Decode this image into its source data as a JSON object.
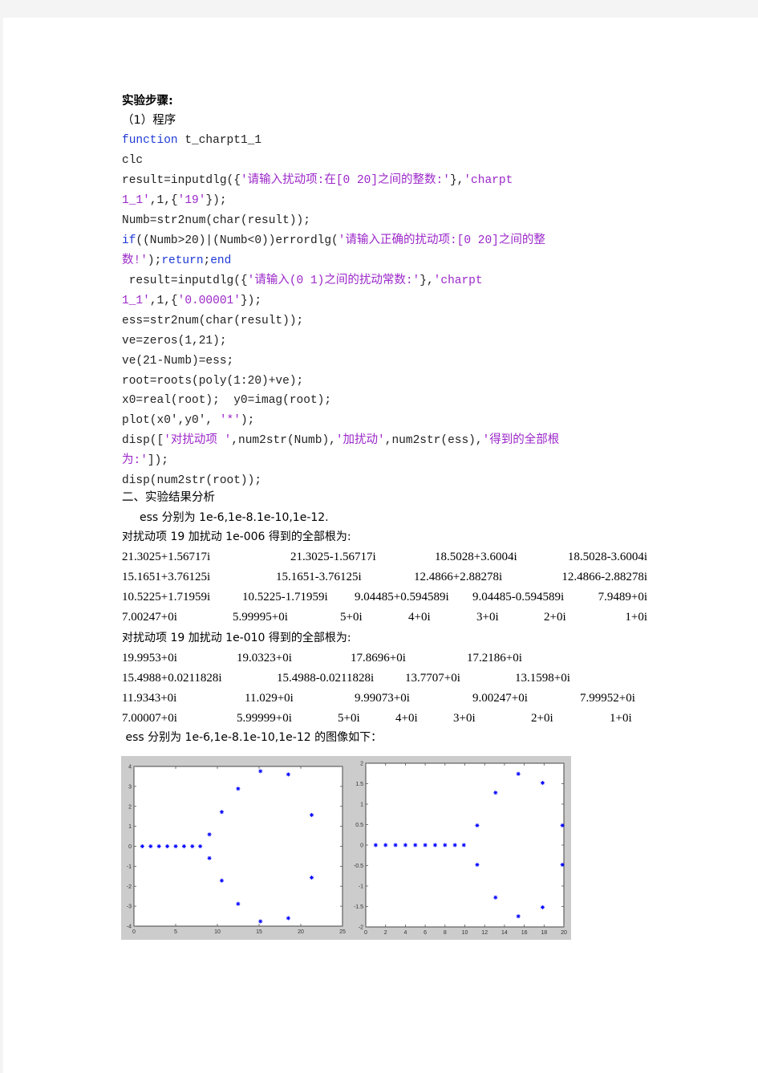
{
  "document": {
    "heading": "实验步骤:",
    "subheading": "（1）程序",
    "code_lines": [
      [
        {
          "t": "function",
          "c": "kw"
        },
        {
          "t": " t_charpt1_1",
          "c": ""
        }
      ],
      [
        {
          "t": "clc",
          "c": ""
        }
      ],
      [
        {
          "t": "result=inputdlg({",
          "c": ""
        },
        {
          "t": "'请输入扰动项:在[0 20]之间的整数:'",
          "c": "str"
        },
        {
          "t": "},",
          "c": ""
        },
        {
          "t": "'charpt",
          "c": "str"
        }
      ],
      [
        {
          "t": "1_1'",
          "c": "str"
        },
        {
          "t": ",1,{",
          "c": ""
        },
        {
          "t": "'19'",
          "c": "str"
        },
        {
          "t": "});",
          "c": ""
        }
      ],
      [
        {
          "t": "Numb=str2num(char(result));",
          "c": ""
        }
      ],
      [
        {
          "t": "if",
          "c": "kw"
        },
        {
          "t": "((Numb>20)|(Numb<0))errordlg(",
          "c": ""
        },
        {
          "t": "'请输入正确的扰动项:[0 20]之间的整",
          "c": "str"
        }
      ],
      [
        {
          "t": "数!'",
          "c": "str"
        },
        {
          "t": ");",
          "c": ""
        },
        {
          "t": "return",
          "c": "kw"
        },
        {
          "t": ";",
          "c": ""
        },
        {
          "t": "end",
          "c": "kw"
        }
      ],
      [
        {
          "t": " result=inputdlg({",
          "c": ""
        },
        {
          "t": "'请输入(0 1)之间的扰动常数:'",
          "c": "str"
        },
        {
          "t": "},",
          "c": ""
        },
        {
          "t": "'charpt",
          "c": "str"
        }
      ],
      [
        {
          "t": "1_1'",
          "c": "str"
        },
        {
          "t": ",1,{",
          "c": ""
        },
        {
          "t": "'0.00001'",
          "c": "str"
        },
        {
          "t": "});",
          "c": ""
        }
      ],
      [
        {
          "t": "ess=str2num(char(result));",
          "c": ""
        }
      ],
      [
        {
          "t": "ve=zeros(1,21);",
          "c": ""
        }
      ],
      [
        {
          "t": "ve(21-Numb)=ess;",
          "c": ""
        }
      ],
      [
        {
          "t": "root=roots(poly(1:20)+ve);",
          "c": ""
        }
      ],
      [
        {
          "t": "x0=real(root);  y0=imag(root);",
          "c": ""
        }
      ],
      [
        {
          "t": "plot(x0',y0', ",
          "c": ""
        },
        {
          "t": "'*'",
          "c": "str"
        },
        {
          "t": ");",
          "c": ""
        }
      ],
      [
        {
          "t": "disp([",
          "c": ""
        },
        {
          "t": "'对扰动项 '",
          "c": "str"
        },
        {
          "t": ",num2str(Numb),",
          "c": ""
        },
        {
          "t": "'加扰动'",
          "c": "str"
        },
        {
          "t": ",num2str(ess),",
          "c": ""
        },
        {
          "t": "'得到的全部根",
          "c": "str"
        }
      ],
      [
        {
          "t": "为:'",
          "c": "str"
        },
        {
          "t": "]);",
          "c": ""
        }
      ],
      [
        {
          "t": "disp(num2str(root));",
          "c": ""
        }
      ]
    ],
    "section2_title": "二、实验结果分析",
    "ess_note": "ess 分别为 1e-6,1e-8.1e-10,1e-12.",
    "result1_title": "对扰动项 19 加扰动 1e-006 得到的全部根为:",
    "result1_rows": [
      [
        "21.3025+1.56717i",
        "21.3025-1.56717i",
        "18.5028+3.6004i",
        "18.5028-3.6004i"
      ],
      [
        "15.1651+3.76125i",
        "15.1651-3.76125i",
        "12.4866+2.88278i",
        "12.4866-2.88278i"
      ],
      [
        "10.5225+1.71959i",
        "10.5225-1.71959i",
        "9.04485+0.594589i",
        "9.04485-0.594589i",
        "7.9489+0i"
      ],
      [
        "7.00247+0i",
        "5.99995+0i",
        "5+0i",
        "4+0i",
        "3+0i",
        "2+0i",
        "1+0i"
      ]
    ],
    "result2_title": "对扰动项 19 加扰动 1e-010 得到的全部根为:",
    "result2_rows": [
      [
        "19.9953+0i",
        "19.0323+0i",
        "17.8696+0i",
        "17.2186+0i"
      ],
      [
        "15.4988+0.0211828i",
        "15.4988-0.0211828i",
        "13.7707+0i",
        "13.1598+0i"
      ],
      [
        "11.9343+0i",
        "11.029+0i",
        "9.99073+0i",
        "9.00247+0i",
        "7.99952+0i"
      ],
      [
        "7.00007+0i",
        "5.99999+0i",
        "5+0i",
        "4+0i",
        "3+0i",
        "2+0i",
        "1+0i"
      ]
    ],
    "figure_caption": " ess 分别为 1e-6,1e-8.1e-10,1e-12 的图像如下："
  },
  "chart_data": [
    {
      "type": "scatter",
      "title": "",
      "xlabel": "",
      "ylabel": "",
      "marker": "*",
      "color": "#0000ff",
      "xlim": [
        0,
        25
      ],
      "ylim": [
        -4,
        4
      ],
      "xticks": [
        0,
        5,
        10,
        15,
        20,
        25
      ],
      "yticks": [
        -4,
        -3,
        -2,
        -1,
        0,
        1,
        2,
        3,
        4
      ],
      "grid": false,
      "x": [
        1,
        2,
        3,
        4,
        5,
        6,
        7,
        7.9489,
        9.04485,
        9.04485,
        10.5225,
        10.5225,
        12.4866,
        12.4866,
        15.1651,
        15.1651,
        18.5028,
        18.5028,
        21.3025,
        21.3025
      ],
      "y": [
        0,
        0,
        0,
        0,
        0,
        0,
        0,
        0,
        0.594589,
        -0.594589,
        1.71959,
        -1.71959,
        2.88278,
        -2.88278,
        3.76125,
        -3.76125,
        3.6004,
        -3.6004,
        1.56717,
        -1.56717
      ]
    },
    {
      "type": "scatter",
      "title": "",
      "xlabel": "",
      "ylabel": "",
      "marker": "*",
      "color": "#0000ff",
      "xlim": [
        0,
        20
      ],
      "ylim": [
        -2,
        2
      ],
      "xticks": [
        0,
        2,
        4,
        6,
        8,
        10,
        12,
        14,
        16,
        18,
        20
      ],
      "yticks": [
        -2,
        -1.5,
        -1,
        -0.5,
        0,
        0.5,
        1,
        1.5,
        2
      ],
      "grid": false,
      "x": [
        1,
        2,
        3,
        4,
        5,
        6,
        7,
        8,
        9,
        9.9,
        11.25,
        11.25,
        13.1,
        13.1,
        15.4,
        15.4,
        17.85,
        17.85,
        19.85,
        19.85
      ],
      "y": [
        0,
        0,
        0,
        0,
        0,
        0,
        0,
        0,
        0,
        0,
        0.48,
        -0.48,
        1.28,
        -1.28,
        1.74,
        -1.74,
        1.52,
        -1.52,
        0.48,
        -0.48
      ]
    }
  ]
}
